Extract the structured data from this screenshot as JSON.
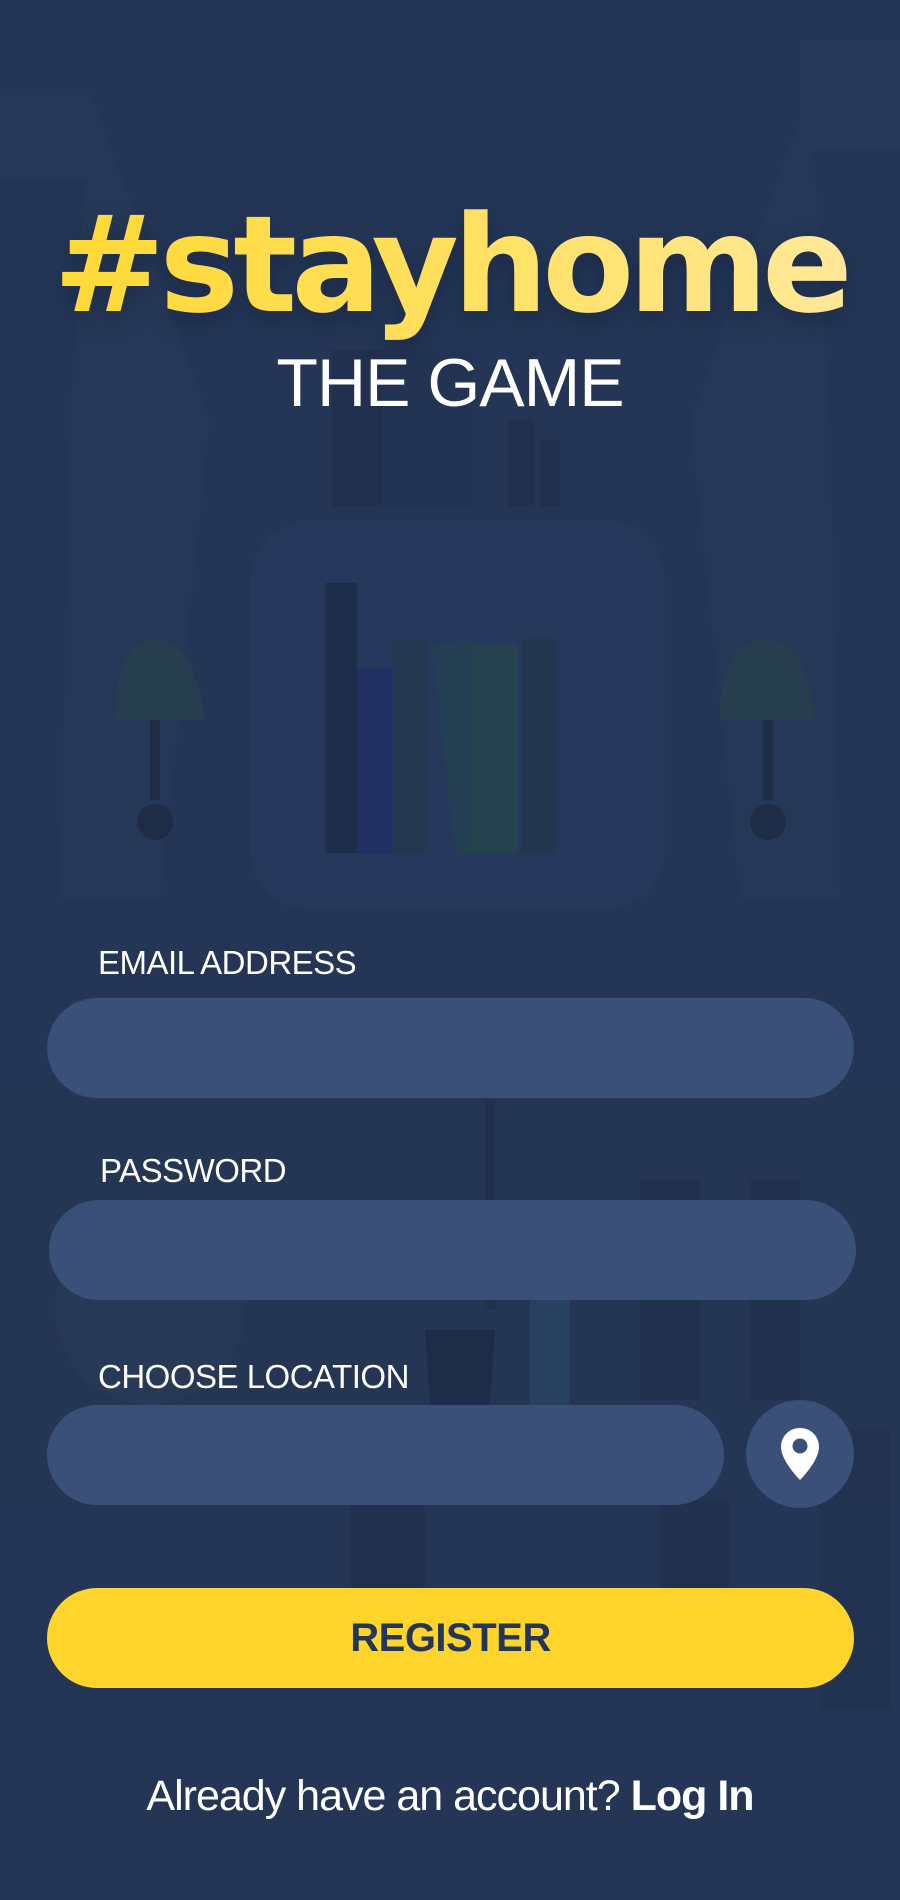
{
  "brand": {
    "logo_text": "#stayhome",
    "subtitle": "THE GAME"
  },
  "form": {
    "email": {
      "label": "EMAIL ADDRESS",
      "value": "",
      "placeholder": ""
    },
    "password": {
      "label": "PASSWORD",
      "value": "",
      "placeholder": ""
    },
    "location": {
      "label": "CHOOSE LOCATION",
      "value": "",
      "placeholder": "",
      "button_icon": "location-pin-icon"
    },
    "register_label": "REGISTER"
  },
  "footer": {
    "prompt": "Already have an account?",
    "login_label": "Log In"
  },
  "colors": {
    "background": "#243556",
    "input_fill": "#3a5078",
    "accent_yellow": "#ffd52b",
    "text": "#ffffff"
  }
}
